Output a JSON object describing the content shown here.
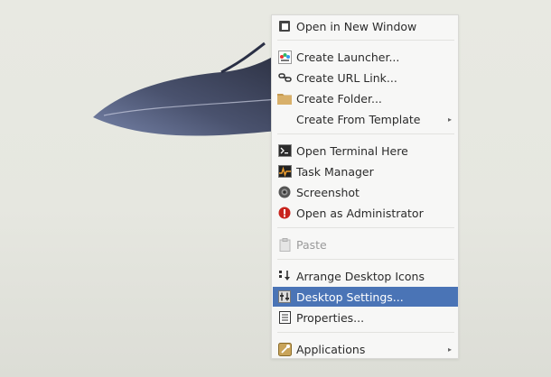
{
  "menu": {
    "items": [
      {
        "label": "Open in New Window",
        "icon": "window-icon"
      },
      {
        "label": "Create Launcher...",
        "icon": "launcher-icon"
      },
      {
        "label": "Create URL Link...",
        "icon": "url-link-icon"
      },
      {
        "label": "Create Folder...",
        "icon": "folder-icon"
      },
      {
        "label": "Create From Template",
        "icon": "",
        "submenu": true
      },
      {
        "label": "Open Terminal Here",
        "icon": "terminal-icon"
      },
      {
        "label": "Task Manager",
        "icon": "task-manager-icon"
      },
      {
        "label": "Screenshot",
        "icon": "camera-icon"
      },
      {
        "label": "Open as Administrator",
        "icon": "admin-icon"
      },
      {
        "label": "Paste",
        "icon": "paste-icon",
        "disabled": true
      },
      {
        "label": "Arrange Desktop Icons",
        "icon": "arrange-icon"
      },
      {
        "label": "Desktop Settings...",
        "icon": "settings-icon",
        "selected": true
      },
      {
        "label": "Properties...",
        "icon": "properties-icon"
      },
      {
        "label": "Applications",
        "icon": "applications-icon",
        "submenu": true
      }
    ],
    "submenu_arrow": "▸",
    "selected_color": "#4a74b6"
  }
}
